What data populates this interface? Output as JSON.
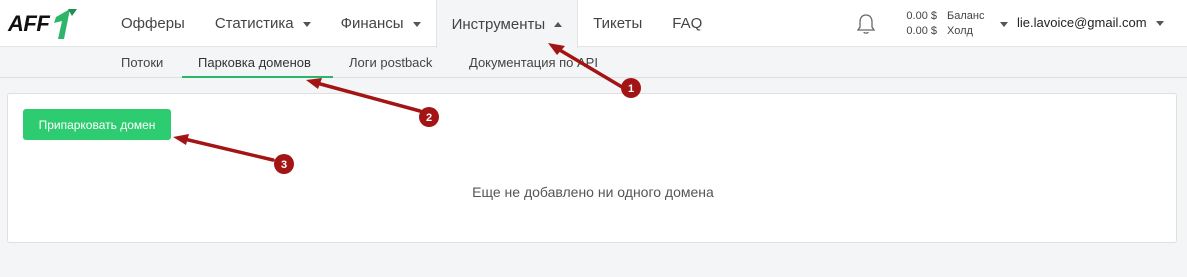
{
  "logo": {
    "text": "AFF",
    "mark": "1",
    "mark_color": "#2db66a"
  },
  "nav": {
    "items": [
      {
        "label": "Офферы",
        "dropdown": false
      },
      {
        "label": "Статистика",
        "dropdown": true
      },
      {
        "label": "Финансы",
        "dropdown": true
      },
      {
        "label": "Инструменты",
        "dropdown": true,
        "active": true
      },
      {
        "label": "Тикеты",
        "dropdown": false
      },
      {
        "label": "FAQ",
        "dropdown": false
      }
    ]
  },
  "header": {
    "notification_icon": "bell-icon",
    "balance_value": "0.00 $",
    "hold_value": "0.00 $",
    "balance_label": "Баланс",
    "hold_label": "Холд",
    "user_email": "lie.lavoice@gmail.com"
  },
  "subnav": {
    "items": [
      {
        "label": "Потоки"
      },
      {
        "label": "Парковка доменов",
        "active": true
      },
      {
        "label": "Логи postback"
      },
      {
        "label": "Документация по API"
      }
    ]
  },
  "main": {
    "park_button_label": "Припарковать домен",
    "empty_message": "Еще не добавлено ни одного домена"
  },
  "annotations": {
    "markers": [
      "1",
      "2",
      "3"
    ],
    "color": "#a31515"
  },
  "colors": {
    "accent_green": "#2ecc71",
    "active_underline": "#2db66a"
  }
}
